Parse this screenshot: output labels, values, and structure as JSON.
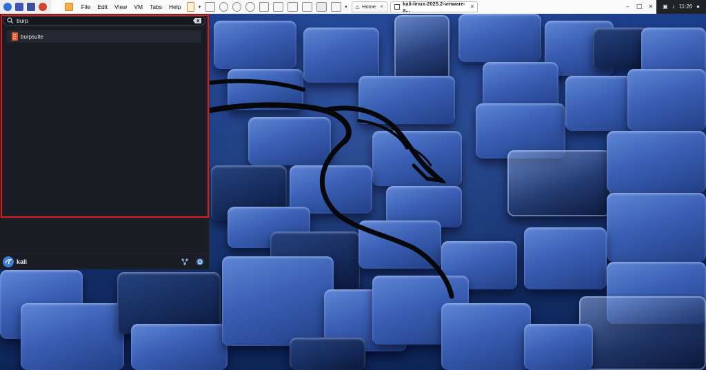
{
  "menu": {
    "items": [
      "File",
      "Edit",
      "View",
      "VM",
      "Tabs",
      "Help"
    ]
  },
  "tabs": [
    {
      "label": "Home",
      "icon": "home-icon"
    },
    {
      "label": "kali-linux-2025.2-vmware-a...",
      "icon": "vm-icon"
    }
  ],
  "tray": {
    "time": "11:26"
  },
  "launcher": {
    "search": {
      "value": "burp",
      "icon": "search-icon",
      "clear_icon": "clear-text-icon"
    },
    "results": [
      {
        "label": "burpsuite",
        "icon": "burpsuite-icon"
      }
    ],
    "user": {
      "name": "kali",
      "avatar_icon": "kali-dragon-icon"
    },
    "bottom_icons": [
      "network-icon",
      "power-icon"
    ]
  },
  "colors": {
    "highlight_border": "#e01c1c",
    "launcher_bg": "#1a1d23",
    "accent": "#3d7fd9"
  }
}
